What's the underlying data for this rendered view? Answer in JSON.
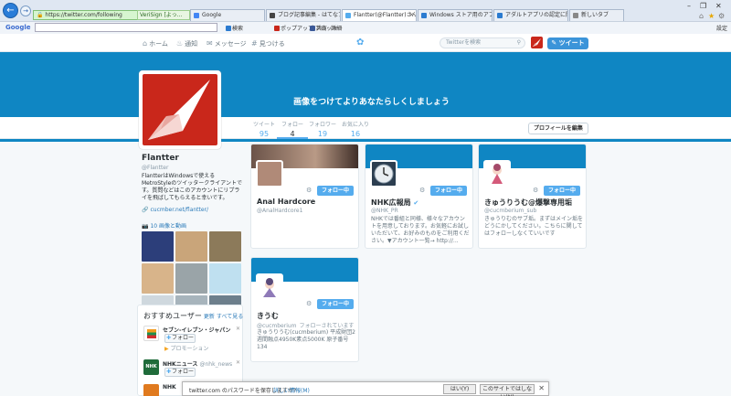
{
  "browser": {
    "url": "https://twitter.com/following",
    "cert": "VeriSign [よっ...",
    "tabs": [
      {
        "label": "Google",
        "color": "#4285f4"
      },
      {
        "label": "ブログ記事編集 - はてなブログ",
        "color": "#444444"
      },
      {
        "label": "Flantter(@Flantter)さん |...",
        "color": "#55acee"
      },
      {
        "label": "Windows ストア用のアプリ認定...",
        "color": "#2b7bd0"
      },
      {
        "label": "アダルトアプリの認定に関して",
        "color": "#2b7bd0"
      },
      {
        "label": "新しいタブ",
        "color": "#888888"
      }
    ],
    "google_label": "Google",
    "toolbar": [
      {
        "label": "検索",
        "color": "#2b7bd0"
      },
      {
        "label": "ポップアップ ブロッカー",
        "color": "#c9271b"
      },
      {
        "label": "共有",
        "color": "#3b5998"
      },
      {
        "label": "詳細",
        "color": "#555555"
      }
    ],
    "settings_label": "設定"
  },
  "twitter_nav": {
    "home": "ホーム",
    "notifications": "通知",
    "messages": "メッセージ",
    "discover": "見つける",
    "search_placeholder": "Twitterを検索",
    "tweet_button": "ツイート"
  },
  "banner_text": "画像をつけてよりあなたらしくしましょう",
  "stats": [
    {
      "label": "ツイート",
      "value": "95"
    },
    {
      "label": "フォロー",
      "value": "4"
    },
    {
      "label": "フォロワー",
      "value": "19"
    },
    {
      "label": "お気に入り",
      "value": "16"
    }
  ],
  "edit_profile": "プロフィールを編集",
  "profile": {
    "name": "Flantter",
    "handle": "@Flantter",
    "bio": "FlantterはWindowsで使えるMetroStyleのツイッタークライアントです。質問などはこのアカウントにリプライを飛ばしてもらえると幸いです。",
    "link": "cucmber.net/flantter/",
    "media": "10 画像と動画"
  },
  "thumbnails": [
    "#2c3e7a",
    "#c9a57a",
    "#8c7a5a",
    "#d8b48a",
    "#9aa4a8",
    "#bfe0f0",
    "#cfd8de",
    "#a7b4bc",
    "#6d7f8c"
  ],
  "suggestions": {
    "title": "おすすめユーザー",
    "refresh": "更新",
    "view_all": "すべて見る",
    "items": [
      {
        "name": "セブン‐イレブン・ジャパン",
        "handle": "",
        "follow": "フォロー",
        "promo": "プロモーション",
        "color": "#d12d2d"
      },
      {
        "name": "NHKニュース",
        "handle": "@nhk_news",
        "follow": "フォロー",
        "promo": "",
        "color": "#1f6b3a"
      },
      {
        "name": "NHK",
        "handle": "",
        "follow": "",
        "promo": "",
        "color": "#e07a1f"
      }
    ]
  },
  "cards": [
    {
      "name": "Anal Hardcore",
      "handle": "@AnalHardcore1",
      "follows_you": "",
      "bio": "",
      "follow": "フォロー中",
      "verified": false,
      "ava": "#b08a78"
    },
    {
      "name": "NHK広報局",
      "handle": "@NHK_PR",
      "follows_you": "",
      "bio": "NHKでは番組と同様、様々なアカウントを用意しております。お気軽にお試しいただいて、お好みのものをご利用ください。▼アカウント一覧→ http://...",
      "follow": "フォロー中",
      "verified": true,
      "ava": "#2c3e50"
    },
    {
      "name": "きゅうりうむ@爆撃専用垢",
      "handle": "@cucmberium_sub",
      "follows_you": "",
      "bio": "きゅうりむのサブ垢。まずはメイン垢をどうにかしてください。こちらに関してはフォローしなくていいです",
      "follow": "フォロー中",
      "verified": false,
      "ava": "#f4e4e8"
    },
    {
      "name": "きうむ",
      "handle": "@cucmberium",
      "follows_you": "フォローされています",
      "bio": "きゅうりうむ(cucmberium) 平成財団2週間融点4950K素点5000K 原子番号134",
      "follow": "フォロー中",
      "verified": false,
      "ava": "#f6eef0"
    }
  ],
  "password_bar": {
    "message": "twitter.com のパスワードを保存しますか?",
    "info": "詳しい情報(M)",
    "yes": "はい(Y)",
    "never": "このサイトではしない(N)"
  }
}
